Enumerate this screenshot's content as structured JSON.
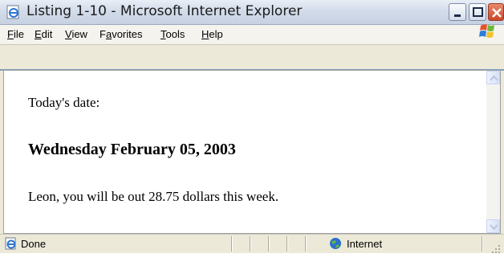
{
  "window": {
    "title": "Listing 1-10 - Microsoft Internet Explorer"
  },
  "menubar": {
    "items": [
      {
        "prefix": "",
        "accel": "F",
        "rest": "ile"
      },
      {
        "prefix": "",
        "accel": "E",
        "rest": "dit"
      },
      {
        "prefix": "",
        "accel": "V",
        "rest": "iew"
      },
      {
        "prefix": "F",
        "accel": "a",
        "rest": "vorites"
      },
      {
        "prefix": "",
        "accel": "T",
        "rest": "ools"
      },
      {
        "prefix": "",
        "accel": "H",
        "rest": "elp"
      }
    ]
  },
  "page": {
    "line1": "Today's date:",
    "date_heading": "Wednesday February 05, 2003",
    "line2": "Leon, you will be out 28.75 dollars this week."
  },
  "statusbar": {
    "status": "Done",
    "zone": "Internet"
  },
  "icons": {
    "title": "ie-page-icon",
    "flag": "windows-flag-icon",
    "status": "ie-page-icon",
    "zone": "globe-icon"
  },
  "colors": {
    "close_button": "#c8492a",
    "border_blue": "#7f9db9"
  }
}
